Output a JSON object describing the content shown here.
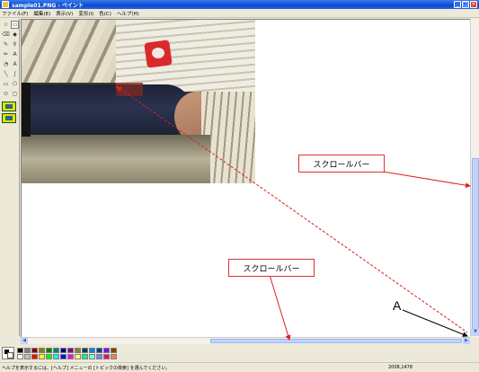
{
  "window": {
    "title": "sample01.PNG - ペイント",
    "buttons": {
      "minimize": "_",
      "maximize": "□",
      "close": "×"
    }
  },
  "menu": [
    "ファイル(F)",
    "編集(E)",
    "表示(V)",
    "変形(I)",
    "色(C)",
    "ヘルプ(H)"
  ],
  "toolbox": {
    "tools": [
      "free-select",
      "rect-select",
      "eraser",
      "fill",
      "color-picker",
      "magnifier",
      "pencil",
      "brush",
      "airbrush",
      "text",
      "line",
      "curve",
      "rectangle",
      "polygon",
      "ellipse",
      "rounded-rect"
    ],
    "icons": [
      "☆",
      "▭",
      "⌫",
      "◆",
      "✎",
      "⚲",
      "✏",
      "A",
      "◔",
      "A",
      "╲",
      "∫",
      "▭",
      "⬠",
      "⬭",
      "▢"
    ]
  },
  "annotations": {
    "scrollbar_label": "スクロールバー",
    "corner_marker": "A"
  },
  "palette": {
    "colors": [
      "#000000",
      "#808080",
      "#800000",
      "#808000",
      "#008000",
      "#008080",
      "#000080",
      "#800080",
      "#808040",
      "#004040",
      "#0080ff",
      "#004080",
      "#8000ff",
      "#804000",
      "#ffffff",
      "#c0c0c0",
      "#ff0000",
      "#ffff00",
      "#00ff00",
      "#00ffff",
      "#0000ff",
      "#ff00ff",
      "#ffff80",
      "#00ff80",
      "#80ffff",
      "#8080ff",
      "#ff0080",
      "#ff8040"
    ]
  },
  "status": {
    "help_text": "ヘルプを表示するには、[ヘルプ] メニューの [トピックの検索] を選んでください。",
    "coordinates": "2008,1478"
  }
}
